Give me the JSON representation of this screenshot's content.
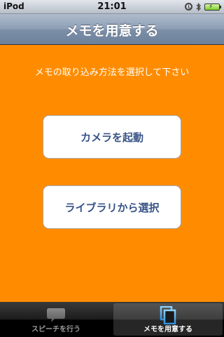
{
  "status_bar": {
    "carrier": "iPod",
    "time": "21:01"
  },
  "nav": {
    "title": "メモを用意する"
  },
  "content": {
    "instruction": "メモの取り込み方法を選択して下さい",
    "camera_button": "カメラを起動",
    "library_button": "ライブラリから選択"
  },
  "tab_bar": {
    "tabs": [
      {
        "label": "スピーチを行う",
        "icon": "speech-bubble-icon",
        "selected": false
      },
      {
        "label": "メモを用意する",
        "icon": "copy-pages-icon",
        "selected": true
      }
    ]
  },
  "colors": {
    "background": "#ff8c00",
    "button_text": "#385487",
    "selected_tab_icon": "#4fb4ff"
  }
}
